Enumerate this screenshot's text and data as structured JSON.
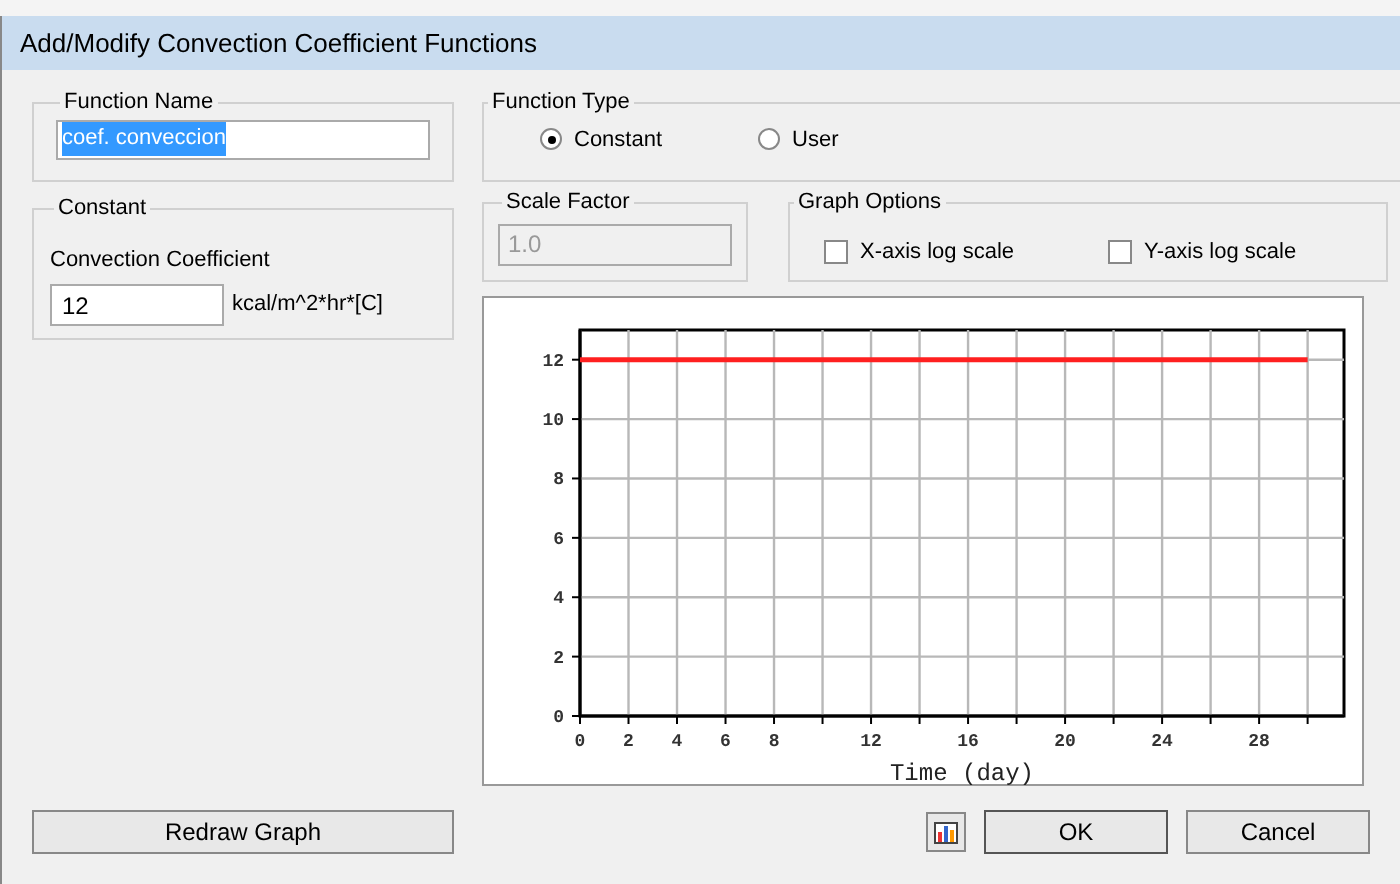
{
  "window": {
    "title": "Add/Modify Convection Coefficient Functions"
  },
  "function_name": {
    "legend": "Function Name",
    "value": "coef. conveccion",
    "highlighted": true
  },
  "constant": {
    "legend": "Constant",
    "field_label": "Convection Coefficient",
    "value": "12",
    "unit": "kcal/m^2*hr*[C]"
  },
  "function_type": {
    "legend": "Function Type",
    "options": [
      {
        "label": "Constant",
        "selected": true
      },
      {
        "label": "User",
        "selected": false
      }
    ]
  },
  "scale_factor": {
    "legend": "Scale Factor",
    "value": "1.0",
    "disabled": true
  },
  "graph_options": {
    "legend": "Graph Options",
    "options": [
      {
        "label": "X-axis log scale",
        "checked": false
      },
      {
        "label": "Y-axis log scale",
        "checked": false
      }
    ]
  },
  "chart": {
    "chart_data": {
      "type": "line",
      "xlabel": "Time (day)",
      "x": [
        0,
        30
      ],
      "series": [
        {
          "color": "#ff2020",
          "values": [
            12,
            12
          ]
        }
      ],
      "grid": true,
      "xlim": [
        0,
        31.5
      ],
      "ylim": [
        0,
        13
      ],
      "xticks": [
        0,
        2,
        4,
        6,
        8,
        12,
        16,
        20,
        24,
        28
      ],
      "yticks": [
        0,
        2,
        4,
        6,
        8,
        10,
        12
      ]
    }
  },
  "buttons": {
    "redraw": "Redraw Graph",
    "ok": "OK",
    "cancel": "Cancel"
  }
}
